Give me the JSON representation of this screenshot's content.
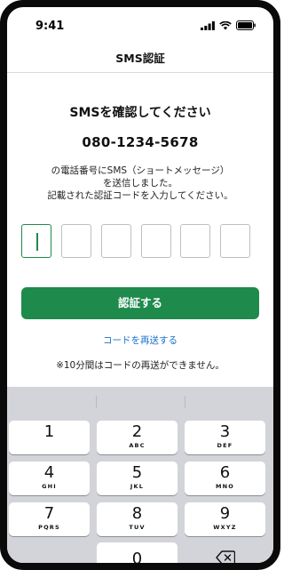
{
  "status": {
    "time": "9:41"
  },
  "nav": {
    "title": "SMS認証"
  },
  "main": {
    "heading": "SMSを確認してください",
    "phone": "080-1234-5678",
    "desc_line1": "の電話番号にSMS（ショートメッセージ）",
    "desc_line2": "を送信しました。",
    "desc_line3": "記載された認証コードを入力してください。",
    "code_digits": [
      "",
      "",
      "",
      "",
      "",
      ""
    ],
    "verify_label": "認証する",
    "resend_label": "コードを再送する",
    "note": "※10分間はコードの再送ができません。"
  },
  "keyboard": {
    "keys": [
      {
        "num": "1",
        "letters": ""
      },
      {
        "num": "2",
        "letters": "ABC"
      },
      {
        "num": "3",
        "letters": "DEF"
      },
      {
        "num": "4",
        "letters": "GHI"
      },
      {
        "num": "5",
        "letters": "JKL"
      },
      {
        "num": "6",
        "letters": "MNO"
      },
      {
        "num": "7",
        "letters": "PQRS"
      },
      {
        "num": "8",
        "letters": "TUV"
      },
      {
        "num": "9",
        "letters": "WXYZ"
      }
    ],
    "zero": "0"
  },
  "colors": {
    "accent": "#1e8a4c",
    "link": "#1a73c8",
    "keyboard_bg": "#d3d4d9"
  }
}
